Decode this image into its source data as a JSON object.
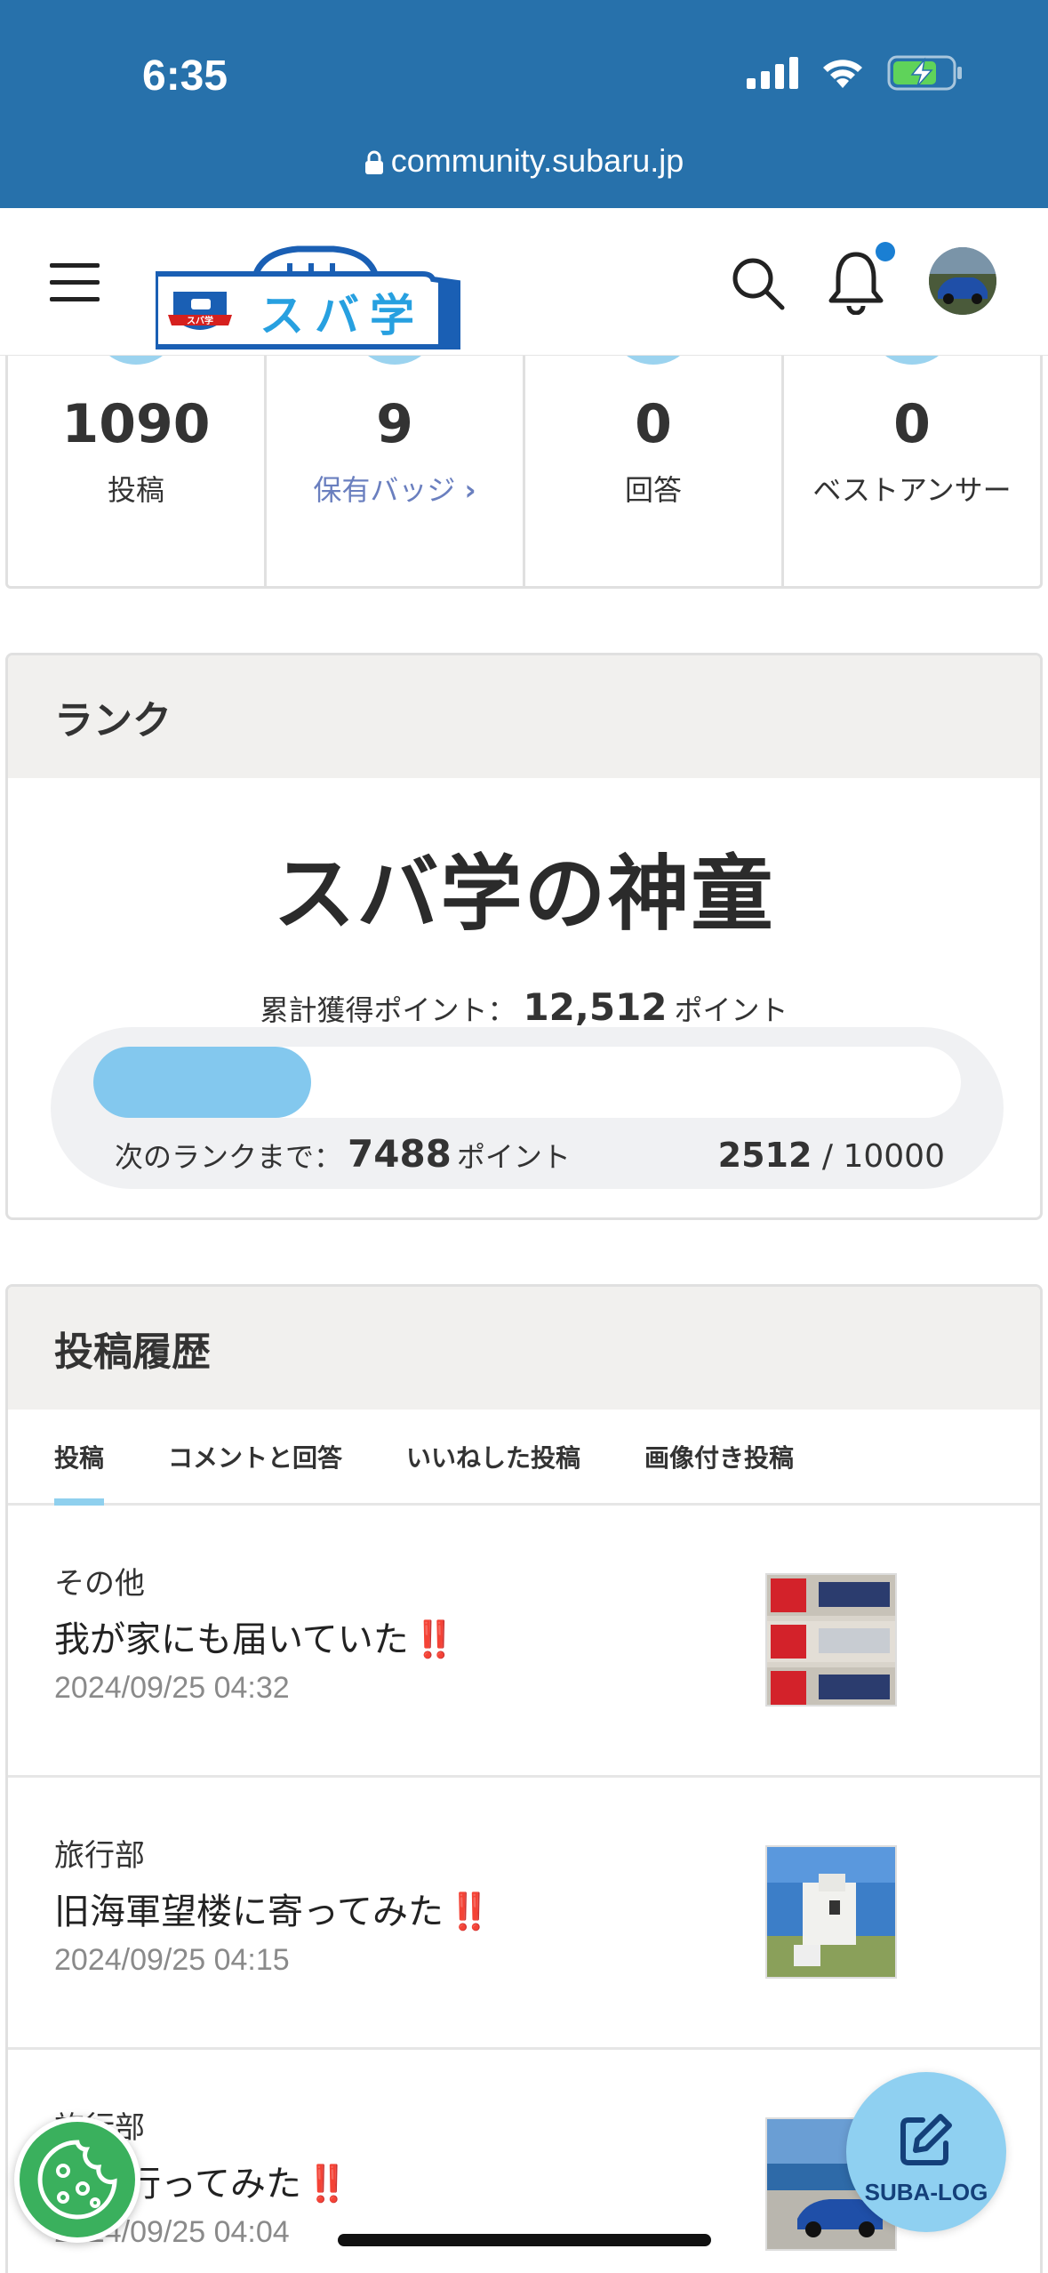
{
  "status": {
    "time": "6:35",
    "url": "community.subaru.jp"
  },
  "header": {
    "logo_text": "スバ学",
    "logo_badge": "スバ学"
  },
  "stats": [
    {
      "value": "1090",
      "label": "投稿"
    },
    {
      "value": "9",
      "label": "保有バッジ",
      "link": "›"
    },
    {
      "value": "0",
      "label": "回答"
    },
    {
      "value": "0",
      "label": "ベストアンサー"
    }
  ],
  "rank": {
    "heading": "ランク",
    "name": "スバ学の神童",
    "total_label": "累計獲得ポイント：",
    "total_value": "12,512",
    "points_unit": "ポイント",
    "next_label": "次のランクまで：",
    "next_value": "7488",
    "progress_current": "2512",
    "progress_sep": "/",
    "progress_max": "10000",
    "progress_fraction": 0.2512
  },
  "history": {
    "heading": "投稿履歴",
    "tabs": [
      "投稿",
      "コメントと回答",
      "いいねした投稿",
      "画像付き投稿"
    ],
    "posts": [
      {
        "category": "その他",
        "title": "我が家にも届いていた",
        "emoji": "‼️",
        "date": "2024/09/25 04:32"
      },
      {
        "category": "旅行部",
        "title": "旧海軍望楼に寄ってみた",
        "emoji": "‼️",
        "date": "2024/09/25 04:15"
      },
      {
        "category": "旅行部",
        "title": "道へ行ってみた",
        "emoji": "‼️",
        "date": "2024/09/25 04:04"
      }
    ]
  },
  "fab": {
    "label": "SUBA-LOG"
  },
  "colors": {
    "brand_blue": "#2771ab",
    "accent_light_blue": "#83c8ee",
    "exclaim_red": "#d6201e"
  }
}
